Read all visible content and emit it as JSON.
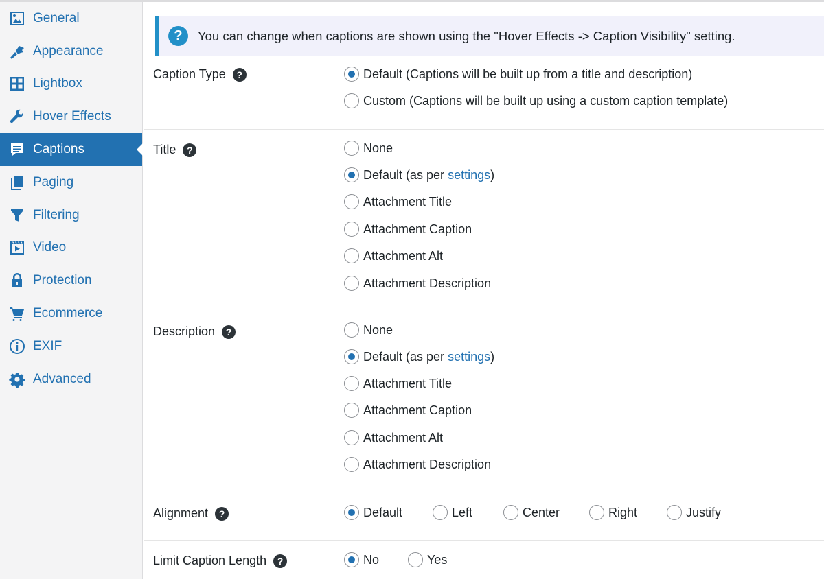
{
  "sidebar": {
    "items": [
      {
        "label": "General",
        "icon": "image-icon",
        "active": false
      },
      {
        "label": "Appearance",
        "icon": "paintbrush-icon",
        "active": false
      },
      {
        "label": "Lightbox",
        "icon": "grid-icon",
        "active": false
      },
      {
        "label": "Hover Effects",
        "icon": "wrench-icon",
        "active": false
      },
      {
        "label": "Captions",
        "icon": "speech-bubble-icon",
        "active": true
      },
      {
        "label": "Paging",
        "icon": "pages-icon",
        "active": false
      },
      {
        "label": "Filtering",
        "icon": "funnel-icon",
        "active": false
      },
      {
        "label": "Video",
        "icon": "video-icon",
        "active": false
      },
      {
        "label": "Protection",
        "icon": "lock-icon",
        "active": false
      },
      {
        "label": "Ecommerce",
        "icon": "cart-icon",
        "active": false
      },
      {
        "label": "EXIF",
        "icon": "info-icon",
        "active": false
      },
      {
        "label": "Advanced",
        "icon": "gear-icon",
        "active": false
      }
    ]
  },
  "notice": {
    "icon": "question-icon",
    "text": "You can change when captions are shown using the \"Hover Effects -> Caption Visibility\" setting."
  },
  "settings": {
    "caption_type": {
      "label": "Caption Type",
      "options": [
        "Default (Captions will be built up from a title and description)",
        "Custom (Captions will be built up using a custom caption template)"
      ],
      "selected": 0
    },
    "title": {
      "label": "Title",
      "options": [
        "None",
        "Default (as per ",
        "Attachment Title",
        "Attachment Caption",
        "Attachment Alt",
        "Attachment Description"
      ],
      "default_link": "settings",
      "default_suffix": ")",
      "selected": 1
    },
    "description": {
      "label": "Description",
      "options": [
        "None",
        "Default (as per ",
        "Attachment Title",
        "Attachment Caption",
        "Attachment Alt",
        "Attachment Description"
      ],
      "default_link": "settings",
      "default_suffix": ")",
      "selected": 1
    },
    "alignment": {
      "label": "Alignment",
      "options": [
        "Default",
        "Left",
        "Center",
        "Right",
        "Justify"
      ],
      "selected": 0
    },
    "limit_caption_length": {
      "label": "Limit Caption Length",
      "options": [
        "No",
        "Yes"
      ],
      "selected": 0
    }
  },
  "help_icon_glyph": "?",
  "colors": {
    "accent": "#2271b1",
    "notice_border": "#2290c8",
    "notice_bg": "#f1f1fb",
    "sidebar_bg": "#f4f4f5"
  }
}
